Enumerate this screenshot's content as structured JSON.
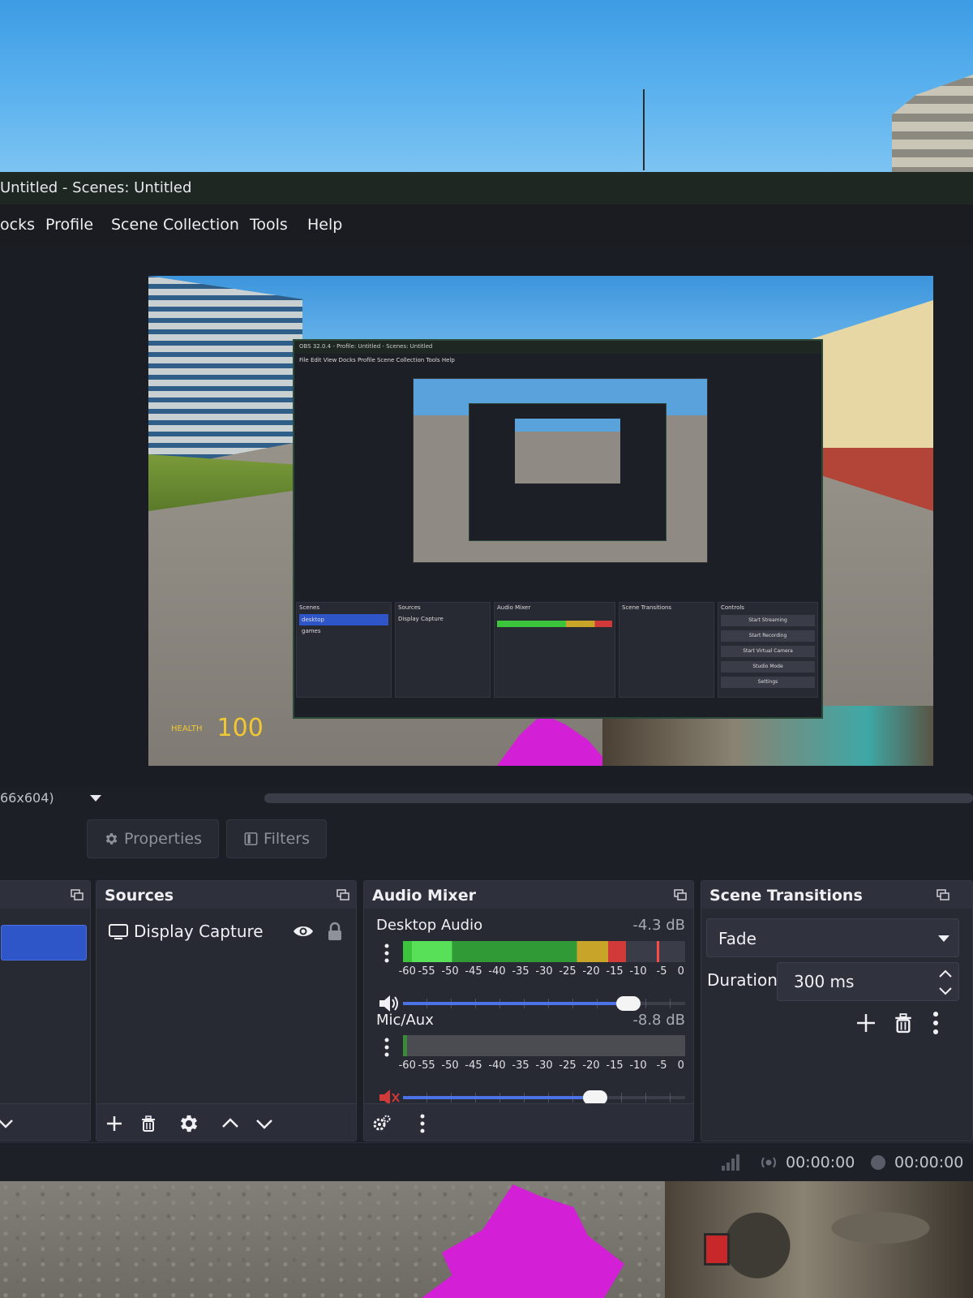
{
  "window": {
    "title": "Untitled - Scenes: Untitled"
  },
  "menu": {
    "items": [
      "ocks",
      "Profile",
      "Scene Collection",
      "Tools",
      "Help"
    ]
  },
  "preview": {
    "health_label": "HEALTH",
    "health_value": "100",
    "nested": {
      "title": "OBS 32.0.4 - Profile: Untitled - Scenes: Untitled",
      "menu": "File   Edit   View   Docks   Profile   Scene Collection   Tools   Help",
      "scenes_title": "Scenes",
      "scene_1": "desktop",
      "scene_2": "games",
      "sources_title": "Sources",
      "source_1": "Display Capture",
      "mixer_title": "Audio Mixer",
      "transitions_title": "Scene Transitions",
      "controls_title": "Controls",
      "ctrl_1": "Start Streaming",
      "ctrl_2": "Start Recording",
      "ctrl_3": "Start Virtual Camera",
      "ctrl_4": "Studio Mode",
      "ctrl_5": "Settings"
    }
  },
  "zoom": {
    "label": "66x604)"
  },
  "toolbar": {
    "properties_label": "Properties",
    "filters_label": "Filters"
  },
  "docks": {
    "sources": {
      "title": "Sources",
      "items": [
        {
          "name": "Display Capture"
        }
      ]
    },
    "mixer": {
      "title": "Audio Mixer",
      "scale": [
        "-60",
        "-55",
        "-50",
        "-45",
        "-40",
        "-35",
        "-30",
        "-25",
        "-20",
        "-15",
        "-10",
        "-5",
        "0"
      ],
      "channels": [
        {
          "name": "Desktop Audio",
          "db": "-4.3 dB",
          "muted": false,
          "level_fraction": 0.79,
          "peak_fraction": 0.9,
          "volume_fraction": 0.8
        },
        {
          "name": "Mic/Aux",
          "db": "-8.8 dB",
          "muted": true,
          "level_fraction": 0.015,
          "peak_fraction": 0.015,
          "volume_fraction": 0.68
        }
      ]
    },
    "transitions": {
      "title": "Scene Transitions",
      "selected": "Fade",
      "duration_label": "Duration",
      "duration_value": "300 ms"
    }
  },
  "status": {
    "stream_time": "00:00:00",
    "record_time": "00:00:00"
  },
  "colors": {
    "accent_blue": "#2f56c8",
    "meter_green": "#3cc43c",
    "meter_yellow": "#c8a428",
    "meter_red": "#d23a3a",
    "muted_red": "#d23a3a"
  }
}
